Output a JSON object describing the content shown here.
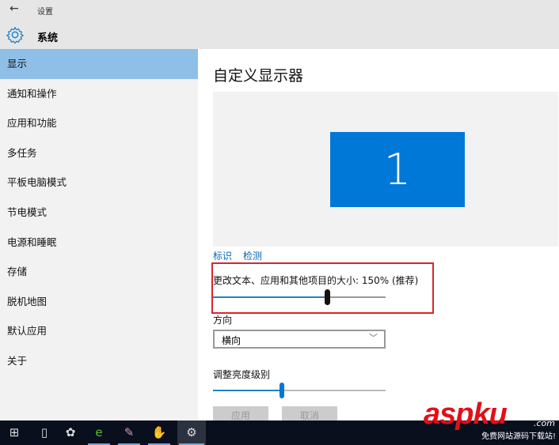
{
  "titlebar": {
    "back_icon": "arrow-left-icon",
    "app_title": "设置",
    "section_icon": "gear-icon",
    "section_title": "系统"
  },
  "sidebar": {
    "items": [
      {
        "label": "显示",
        "active": true
      },
      {
        "label": "通知和操作"
      },
      {
        "label": "应用和功能"
      },
      {
        "label": "多任务"
      },
      {
        "label": "平板电脑模式"
      },
      {
        "label": "节电模式"
      },
      {
        "label": "电源和睡眠"
      },
      {
        "label": "存储"
      },
      {
        "label": "脱机地图"
      },
      {
        "label": "默认应用"
      },
      {
        "label": "关于"
      }
    ]
  },
  "main": {
    "title": "自定义显示器",
    "monitor_number": "1",
    "identify_link": "标识",
    "detect_link": "检测",
    "scale_label": "更改文本、应用和其他项目的大小: 150% (推荐)",
    "scale_slider_fraction": 0.66,
    "orientation_label": "方向",
    "orientation_value": "横向",
    "brightness_label": "调整亮度级别",
    "brightness_slider_fraction": 0.4,
    "apply_button": "应用",
    "cancel_button": "取消",
    "accent_color": "#0078d7",
    "highlight_box_color": "#d9262c"
  },
  "taskbar": {
    "icons": [
      "windows-start-icon",
      "task-view-icon",
      "fan-app-icon",
      "ie-browser-icon",
      "paint-app-icon",
      "baidu-app-icon",
      "settings-gear-icon"
    ]
  },
  "watermark": {
    "logo": "aspku",
    "domain": ".com",
    "tagline": "免费网站源码下载站!"
  }
}
